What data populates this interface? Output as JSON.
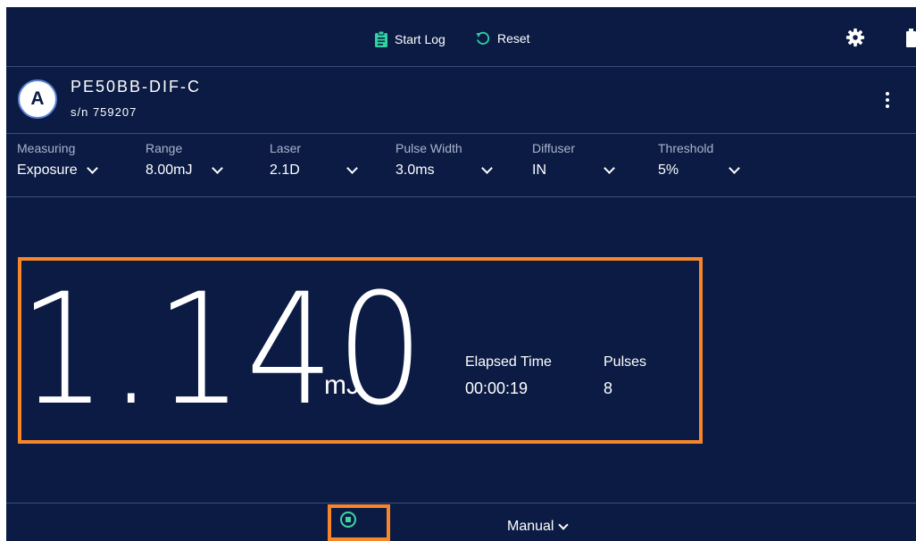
{
  "toolbar": {
    "start_log_label": "Start Log",
    "reset_label": "Reset",
    "accent_color": "#2ed3a0"
  },
  "device": {
    "channel": "A",
    "model": "PE50BB-DIF-C",
    "serial": "s/n 759207"
  },
  "settings": [
    {
      "label": "Measuring",
      "value": "Exposure"
    },
    {
      "label": "Range",
      "value": "8.00mJ"
    },
    {
      "label": "Laser",
      "value": "2.1D"
    },
    {
      "label": "Pulse Width",
      "value": "3.0ms"
    },
    {
      "label": "Diffuser",
      "value": "IN"
    },
    {
      "label": "Threshold",
      "value": "5%"
    }
  ],
  "reading": {
    "value": "1.140",
    "unit": "mJ",
    "elapsed_label": "Elapsed Time",
    "elapsed_value": "00:00:19",
    "pulses_label": "Pulses",
    "pulses_value": "8"
  },
  "bottom": {
    "mode": "Manual"
  },
  "colors": {
    "background": "#0b1b44",
    "highlight": "#f7852a",
    "stop_green": "#3fd6a0"
  }
}
